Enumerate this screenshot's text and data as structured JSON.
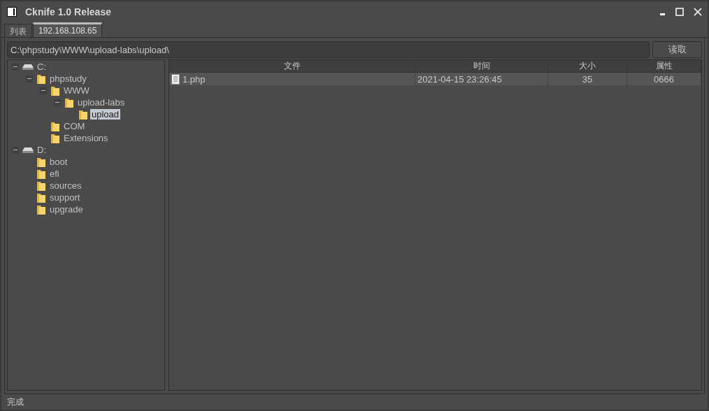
{
  "window": {
    "title": "Cknife 1.0 Release"
  },
  "tabs": [
    {
      "label": "列表",
      "selected": false
    },
    {
      "label": "192.168.108.65",
      "selected": true
    }
  ],
  "path_bar": {
    "value": "C:\\phpstudy\\WWW\\upload-labs\\upload\\",
    "button": "读取"
  },
  "tree": [
    {
      "kind": "drive",
      "label": "C:",
      "expanded": true,
      "selected": false,
      "children": [
        {
          "kind": "folder",
          "label": "phpstudy",
          "expanded": true,
          "selected": false,
          "children": [
            {
              "kind": "folder",
              "label": "WWW",
              "expanded": true,
              "selected": false,
              "children": [
                {
                  "kind": "folder",
                  "label": "upload-labs",
                  "expanded": true,
                  "selected": false,
                  "children": [
                    {
                      "kind": "folder",
                      "label": "upload",
                      "expanded": false,
                      "selected": true
                    }
                  ]
                }
              ]
            },
            {
              "kind": "folder",
              "label": "COM",
              "expanded": false,
              "selected": false
            },
            {
              "kind": "folder",
              "label": "Extensions",
              "expanded": false,
              "selected": false
            }
          ]
        }
      ]
    },
    {
      "kind": "drive",
      "label": "D:",
      "expanded": true,
      "selected": false,
      "children": [
        {
          "kind": "folder",
          "label": "boot",
          "expanded": false,
          "selected": false
        },
        {
          "kind": "folder",
          "label": "efi",
          "expanded": false,
          "selected": false
        },
        {
          "kind": "folder",
          "label": "sources",
          "expanded": false,
          "selected": false
        },
        {
          "kind": "folder",
          "label": "support",
          "expanded": false,
          "selected": false
        },
        {
          "kind": "folder",
          "label": "upgrade",
          "expanded": false,
          "selected": false
        }
      ]
    }
  ],
  "table": {
    "columns": [
      "文件",
      "时间",
      "大小",
      "属性"
    ],
    "rows": [
      {
        "cells": [
          "1.php",
          "2021-04-15 23:26:45",
          "35",
          "0666"
        ]
      }
    ]
  },
  "status_bar": "完成"
}
